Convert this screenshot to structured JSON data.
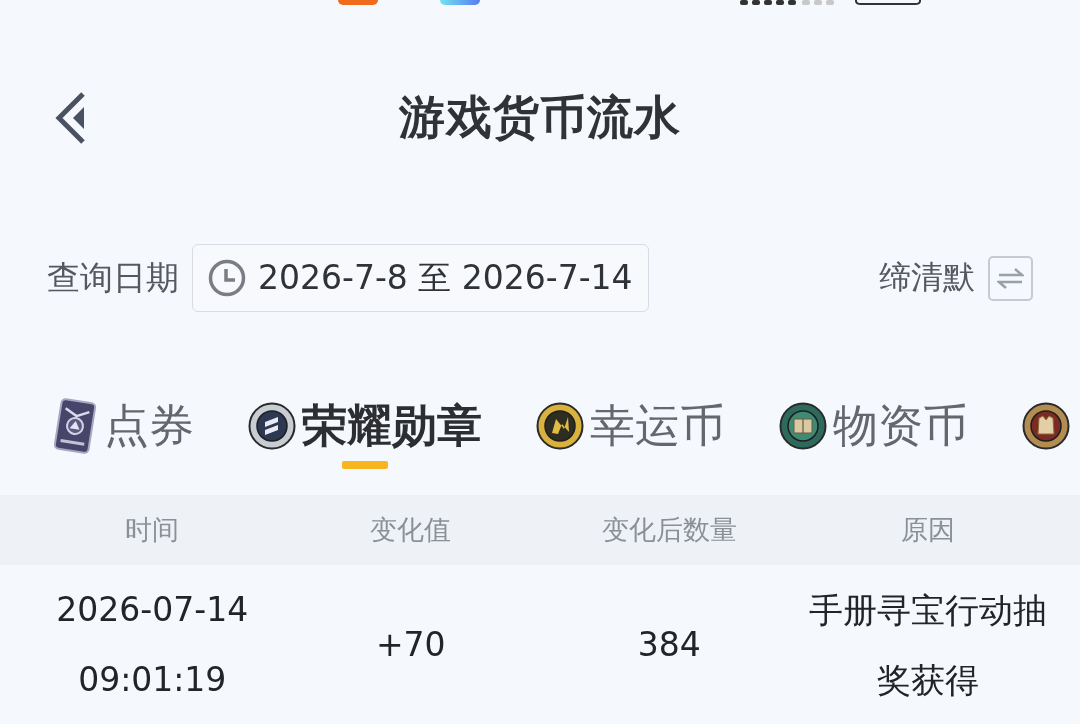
{
  "header": {
    "title": "游戏货币流水"
  },
  "filter": {
    "label": "查询日期",
    "date_range": "2026-7-8 至 2026-7-14",
    "toggle_label": "缔清默"
  },
  "tabs": [
    {
      "label": "点券",
      "selected": false
    },
    {
      "label": "荣耀勋章",
      "selected": true
    },
    {
      "label": "幸运币",
      "selected": false
    },
    {
      "label": "物资币",
      "selected": false
    },
    {
      "selected": false
    }
  ],
  "table": {
    "columns": [
      "时间",
      "变化值",
      "变化后数量",
      "原因"
    ],
    "rows": [
      [
        "2026-07-14 09:01:19",
        "+70",
        "384",
        "手册寻宝行动抽奖获得"
      ]
    ]
  }
}
